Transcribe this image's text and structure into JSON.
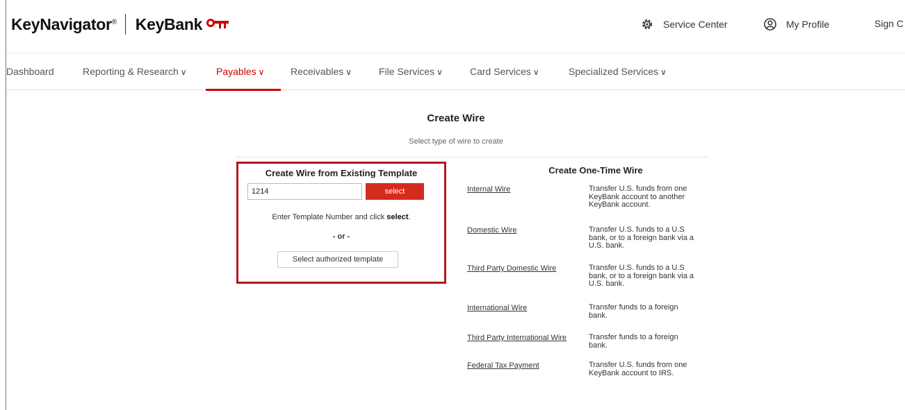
{
  "header": {
    "brand_name": "KeyNavigator",
    "brand_mark": "®",
    "bank_name": "KeyBank",
    "service_center": "Service Center",
    "my_profile": "My Profile",
    "sign_out": "Sign C",
    "brand_color": "#cc0000"
  },
  "nav": {
    "items": [
      {
        "label": "Dashboard",
        "has_chevron": false
      },
      {
        "label": "Reporting & Research",
        "has_chevron": true
      },
      {
        "label": "Payables",
        "has_chevron": true,
        "active": true
      },
      {
        "label": "Receivables",
        "has_chevron": true
      },
      {
        "label": "File Services",
        "has_chevron": true
      },
      {
        "label": "Card Services",
        "has_chevron": true
      },
      {
        "label": "Specialized Services",
        "has_chevron": true
      }
    ],
    "chevron": "∨"
  },
  "page": {
    "title": "Create Wire",
    "subtitle": "Select type of wire to create"
  },
  "template_section": {
    "title": "Create Wire from Existing Template",
    "input_value": "1214",
    "select_label": "select",
    "hint_prefix": "Enter Template Number and click ",
    "hint_bold": "select",
    "hint_suffix": ".",
    "or_label": "- or -",
    "authorized_label": "Select authorized template",
    "highlight_color": "#b3171f"
  },
  "one_time_section": {
    "title": "Create One-Time Wire",
    "options": [
      {
        "link": "Internal Wire",
        "description": "Transfer U.S. funds from one KeyBank account to another KeyBank account."
      },
      {
        "link": "Domestic Wire",
        "description": "Transfer U.S. funds to a U.S bank, or to a foreign bank via a U.S. bank."
      },
      {
        "link": "Third Party Domestic Wire",
        "description": "Transfer U.S. funds to a U.S bank, or to a foreign bank via a U.S. bank."
      },
      {
        "link": "International Wire",
        "description": "Transfer funds to a foreign bank."
      },
      {
        "link": "Third Party International Wire",
        "description": "Transfer funds to a foreign bank."
      },
      {
        "link": "Federal Tax Payment",
        "description": "Transfer U.S. funds from one KeyBank account to IRS."
      }
    ]
  }
}
